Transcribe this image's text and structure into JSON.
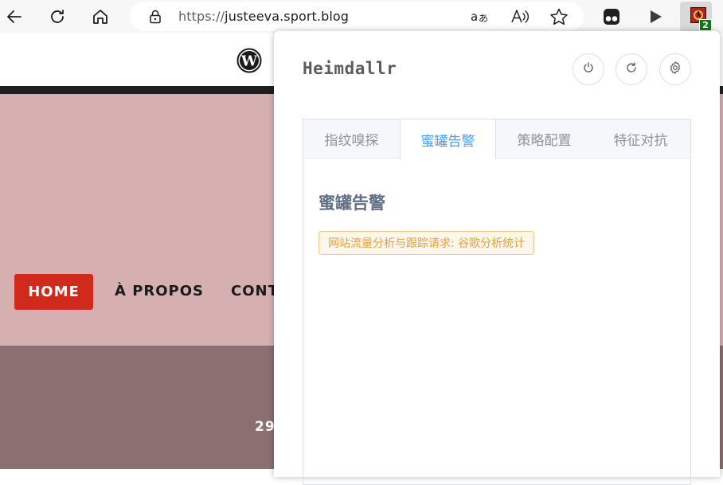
{
  "browser": {
    "url_scheme": "https://",
    "url_host": "justeeva.sport.blog",
    "extension_badge": "2"
  },
  "site": {
    "nav": [
      {
        "label": "HOME"
      },
      {
        "label": "À PROPOS"
      },
      {
        "label": "CONT"
      }
    ],
    "date_fragment": "29"
  },
  "popup": {
    "title": "Heimdallr",
    "tabs": [
      {
        "label": "指纹嗅探"
      },
      {
        "label": "蜜罐告警"
      },
      {
        "label": "策略配置"
      },
      {
        "label": "特征对抗"
      }
    ],
    "active_tab": 1,
    "section_title": "蜜罐告警",
    "alert_tag": "网站流量分析与跟踪请求: 谷歌分析统计"
  },
  "colors": {
    "accent": "#409eff",
    "warning": "#e6a23c",
    "nav_home": "#cf2a1c",
    "hero": "#d6b0b0"
  }
}
